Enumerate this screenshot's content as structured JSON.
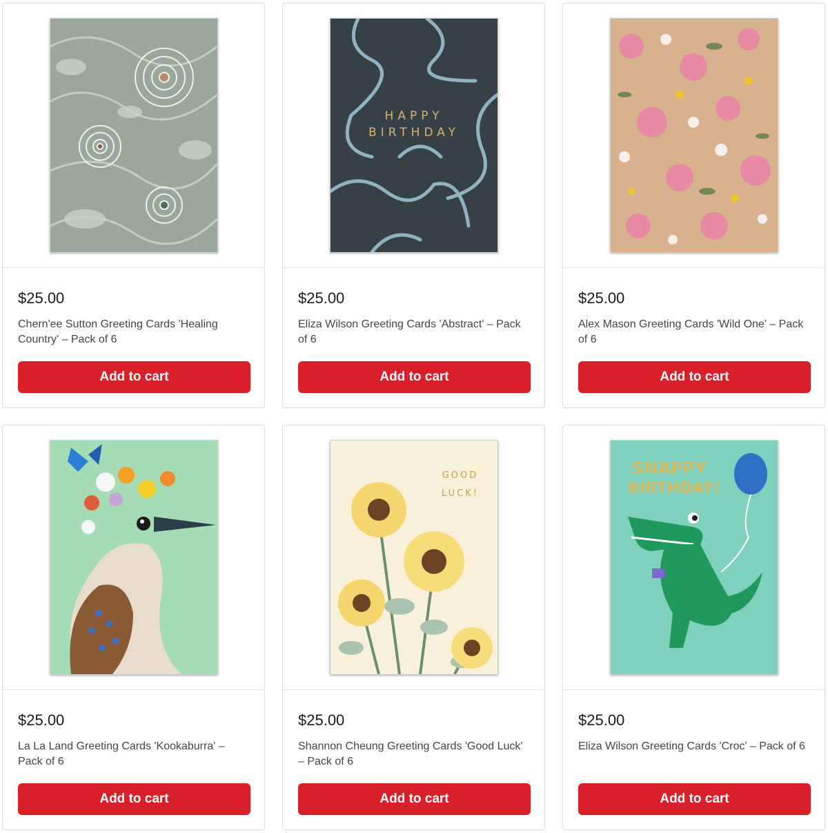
{
  "products": [
    {
      "price": "$25.00",
      "title": "Chern'ee Sutton Greeting Cards 'Healing Country' – Pack of 6",
      "button": "Add to cart",
      "image_desc": "aboriginal-dot-art-card"
    },
    {
      "price": "$25.00",
      "title": "Eliza Wilson Greeting Cards 'Abstract' – Pack of 6",
      "button": "Add to cart",
      "image_desc": "happy-birthday-abstract-card",
      "card_text": [
        "HAPPY",
        "BIRTHDAY"
      ]
    },
    {
      "price": "$25.00",
      "title": "Alex Mason Greeting Cards 'Wild One' – Pack of 6",
      "button": "Add to cart",
      "image_desc": "wildflower-pattern-card"
    },
    {
      "price": "$25.00",
      "title": "La La Land Greeting Cards 'Kookaburra' – Pack of 6",
      "button": "Add to cart",
      "image_desc": "kookaburra-flower-crown-card"
    },
    {
      "price": "$25.00",
      "title": "Shannon Cheung Greeting Cards 'Good Luck' – Pack of 6",
      "button": "Add to cart",
      "image_desc": "sunflowers-good-luck-card",
      "card_text": [
        "GOOD",
        "LUCK!"
      ]
    },
    {
      "price": "$25.00",
      "title": "Eliza Wilson Greeting Cards 'Croc' – Pack of 6",
      "button": "Add to cart",
      "image_desc": "crocodile-birthday-card",
      "card_text": [
        "SNAPPY",
        "BIRTHDAY!"
      ]
    }
  ],
  "colors": {
    "button_bg": "#d9202a",
    "card_border": "#dcdcdc"
  }
}
